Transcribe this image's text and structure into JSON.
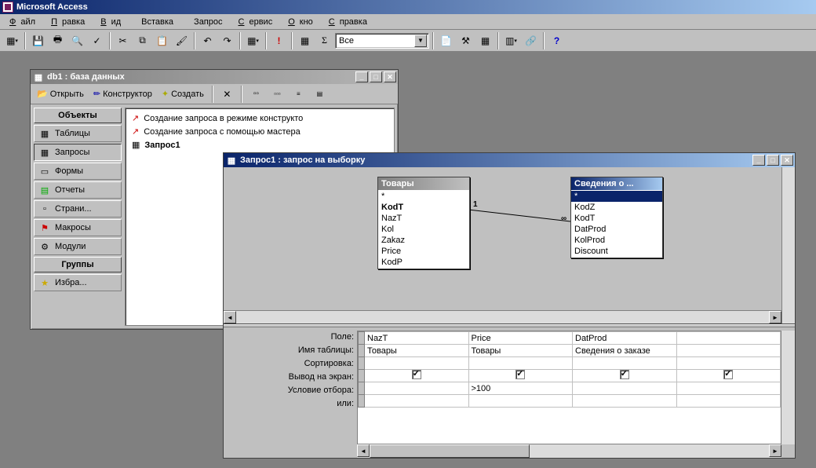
{
  "app_title": "Microsoft Access",
  "menus": [
    "Файл",
    "Правка",
    "Вид",
    "Вставка",
    "Запрос",
    "Сервис",
    "Окно",
    "Справка"
  ],
  "toolbar": {
    "combo_value": "Все"
  },
  "db_window": {
    "title": "db1 : база данных",
    "toolbar": {
      "open": "Открыть",
      "design": "Конструктор",
      "create": "Создать"
    },
    "side_headers": {
      "objects": "Объекты",
      "groups": "Группы"
    },
    "side_items": [
      "Таблицы",
      "Запросы",
      "Формы",
      "Отчеты",
      "Страни...",
      "Макросы",
      "Модули"
    ],
    "side_group_item": "Избра...",
    "list_items": [
      "Создание запроса в режиме конструкто",
      "Создание запроса с помощью мастера",
      "Запрос1"
    ]
  },
  "query_window": {
    "title": "Запрос1 : запрос на выборку",
    "tables": [
      {
        "name": "Товары",
        "fields": [
          "*",
          "KodT",
          "NazT",
          "Kol",
          "Zakaz",
          "Price",
          "KodP"
        ],
        "bold": [
          1
        ]
      },
      {
        "name": "Сведения о ...",
        "fields": [
          "*",
          "KodZ",
          "KodT",
          "DatProd",
          "KolProd",
          "Discount"
        ],
        "sel": [
          0
        ]
      }
    ],
    "link": {
      "left_card": "1",
      "right_card": "∞"
    },
    "grid_labels": [
      "Поле:",
      "Имя таблицы:",
      "Сортировка:",
      "Вывод на экран:",
      "Условие отбора:",
      "или:"
    ],
    "grid": {
      "cols": [
        {
          "field": "NazT",
          "table": "Товары",
          "show": true,
          "criteria": ""
        },
        {
          "field": "Price",
          "table": "Товары",
          "show": true,
          "criteria": ">100"
        },
        {
          "field": "DatProd",
          "table": "Сведения о заказе",
          "show": true,
          "criteria": ""
        },
        {
          "field": "",
          "table": "",
          "show": true,
          "criteria": ""
        }
      ]
    }
  }
}
